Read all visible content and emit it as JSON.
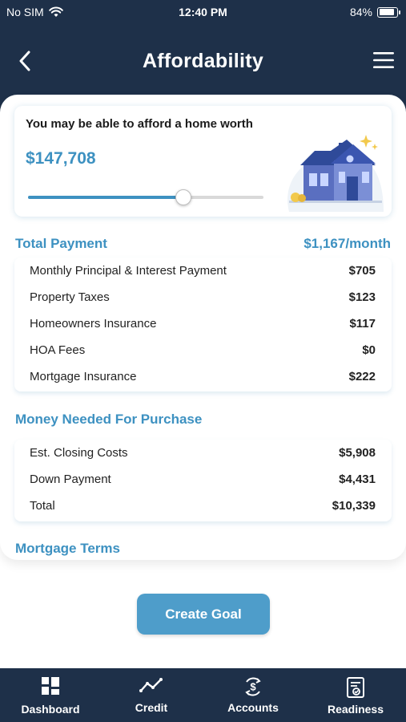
{
  "status_bar": {
    "carrier": "No SIM",
    "time": "12:40 PM",
    "battery": "84%"
  },
  "nav": {
    "title": "Affordability"
  },
  "hero": {
    "label": "You may be able to afford a home worth",
    "amount": "$147,708",
    "slider_value": 0.66
  },
  "total_payment": {
    "title": "Total Payment",
    "value": "$1,167/month",
    "rows": [
      {
        "label": "Monthly Principal & Interest Payment",
        "value": "$705"
      },
      {
        "label": "Property Taxes",
        "value": "$123"
      },
      {
        "label": "Homeowners Insurance",
        "value": "$117"
      },
      {
        "label": "HOA Fees",
        "value": "$0"
      },
      {
        "label": "Mortgage Insurance",
        "value": "$222"
      }
    ]
  },
  "money_needed": {
    "title": "Money Needed For Purchase",
    "rows": [
      {
        "label": "Est. Closing Costs",
        "value": "$5,908"
      },
      {
        "label": "Down Payment",
        "value": "$4,431"
      },
      {
        "label": "Total",
        "value": "$10,339"
      }
    ]
  },
  "mortgage_terms": {
    "title": "Mortgage Terms"
  },
  "create_goal_label": "Create Goal",
  "tabs": [
    {
      "label": "Dashboard",
      "icon": "dashboard-icon"
    },
    {
      "label": "Credit",
      "icon": "trend-line-icon"
    },
    {
      "label": "Accounts",
      "icon": "accounts-dollar-icon"
    },
    {
      "label": "Readiness",
      "icon": "readiness-document-icon"
    }
  ],
  "colors": {
    "header": "#1e3049",
    "accent": "#3d91c1",
    "button": "#4e9dca"
  }
}
